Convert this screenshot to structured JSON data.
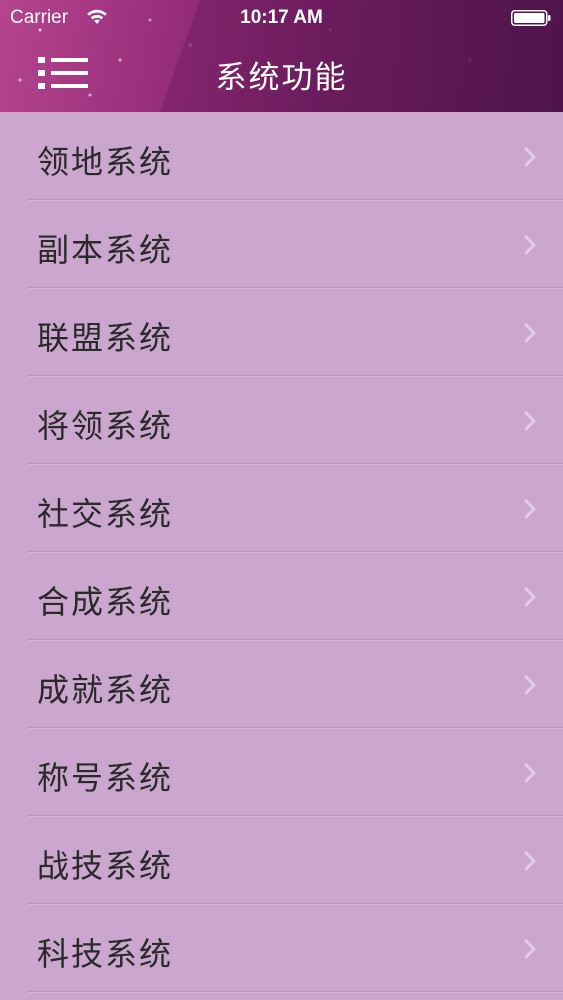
{
  "status_bar": {
    "carrier": "Carrier",
    "time": "10:17 AM",
    "wifi_icon": "wifi-icon",
    "battery_icon": "battery-icon"
  },
  "nav": {
    "title": "系统功能",
    "menu_icon": "hamburger-menu-icon"
  },
  "list": {
    "items": [
      {
        "label": "领地系统"
      },
      {
        "label": "副本系统"
      },
      {
        "label": "联盟系统"
      },
      {
        "label": "将领系统"
      },
      {
        "label": "社交系统"
      },
      {
        "label": "合成系统"
      },
      {
        "label": "成就系统"
      },
      {
        "label": "称号系统"
      },
      {
        "label": "战技系统"
      },
      {
        "label": "科技系统"
      }
    ],
    "chevron_icon": "chevron-right-icon"
  },
  "colors": {
    "list_background": "#cba6cf",
    "header_start": "#b5448f",
    "header_end": "#4a1148",
    "chevron": "#e3cde6",
    "text": "#2a2a2a"
  }
}
